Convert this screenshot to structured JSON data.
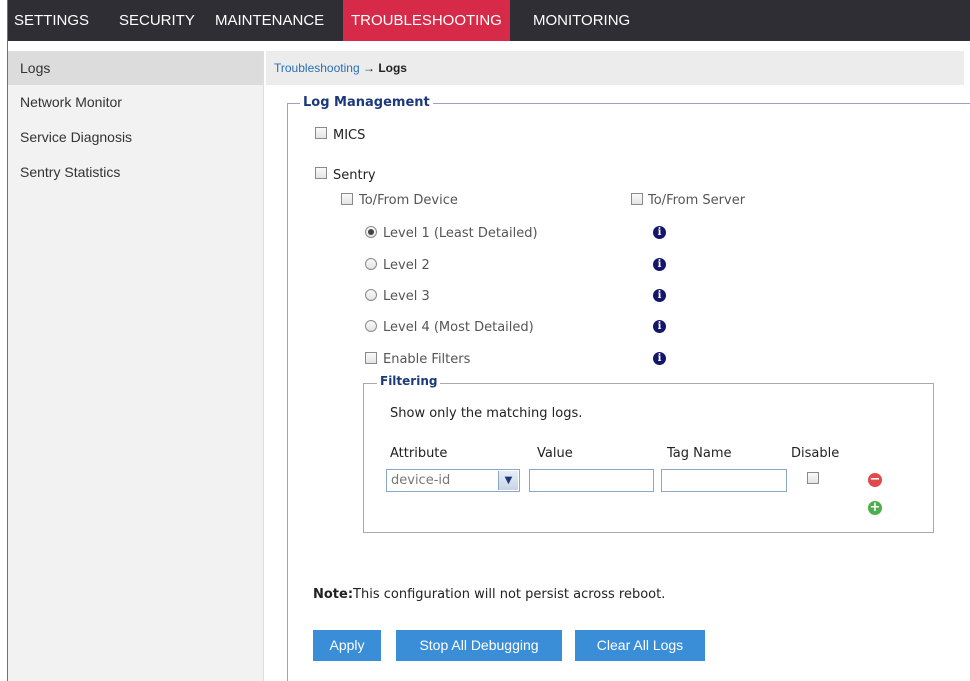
{
  "nav": {
    "items": [
      {
        "label": "SETTINGS",
        "active": false
      },
      {
        "label": "SECURITY",
        "active": false
      },
      {
        "label": "MAINTENANCE",
        "active": false
      },
      {
        "label": "TROUBLESHOOTING",
        "active": true
      },
      {
        "label": "MONITORING",
        "active": false
      }
    ]
  },
  "sidebar": {
    "items": [
      {
        "label": "Logs",
        "active": true
      },
      {
        "label": "Network Monitor",
        "active": false
      },
      {
        "label": "Service Diagnosis",
        "active": false
      },
      {
        "label": "Sentry Statistics",
        "active": false
      }
    ]
  },
  "breadcrumb": {
    "parent": "Troubleshooting",
    "separator": "→",
    "current": "Logs"
  },
  "log_management": {
    "legend": "Log Management",
    "mics": {
      "label": "MICS",
      "checked": false
    },
    "sentry": {
      "label": "Sentry",
      "checked": false
    },
    "to_from_device": {
      "label": "To/From Device",
      "checked": false
    },
    "to_from_server": {
      "label": "To/From Server",
      "checked": false
    },
    "levels": [
      {
        "label": "Level 1 (Least Detailed)",
        "checked": true
      },
      {
        "label": "Level 2",
        "checked": false
      },
      {
        "label": "Level 3",
        "checked": false
      },
      {
        "label": "Level 4 (Most Detailed)",
        "checked": false
      }
    ],
    "enable_filters": {
      "label": "Enable Filters",
      "checked": false
    },
    "info_glyph": "i"
  },
  "filtering": {
    "legend": "Filtering",
    "description": "Show only the matching logs.",
    "columns": {
      "attribute": "Attribute",
      "value": "Value",
      "tag_name": "Tag Name",
      "disable": "Disable"
    },
    "row": {
      "attribute_selected": "device-id",
      "value": "",
      "tag_name": "",
      "disable_checked": false
    },
    "remove_glyph": "−",
    "add_glyph": "+"
  },
  "note": {
    "prefix": "Note:",
    "text": "This configuration will not persist across reboot."
  },
  "buttons": {
    "apply": "Apply",
    "stop_all": "Stop All Debugging",
    "clear_all": "Clear All Logs"
  },
  "colors": {
    "nav_bg": "#2e2e34",
    "nav_active": "#d62a48",
    "button_blue": "#3a8ed8",
    "info_blue": "#13166a",
    "remove_red": "#e04a4a",
    "add_green": "#4cae4c"
  },
  "icons": {
    "info": "info-circle-icon",
    "remove": "minus-circle-icon",
    "add": "plus-circle-icon",
    "dropdown": "chevron-down-icon"
  }
}
